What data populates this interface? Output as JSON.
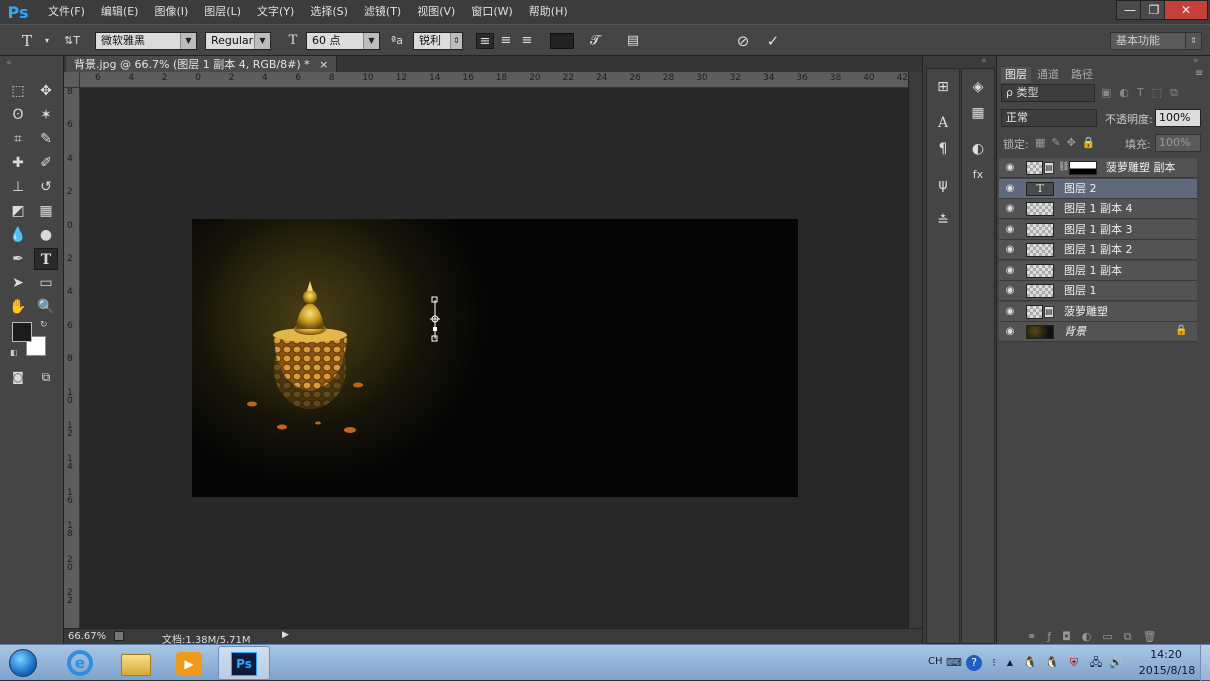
{
  "app": {
    "logo": "Ps",
    "menus": [
      "文件(F)",
      "编辑(E)",
      "图像(I)",
      "图层(L)",
      "文字(Y)",
      "选择(S)",
      "滤镜(T)",
      "视图(V)",
      "窗口(W)",
      "帮助(H)"
    ],
    "window_controls": {
      "minimize": "—",
      "restore": "❐",
      "close": "✕"
    }
  },
  "options": {
    "tool_glyph": "T",
    "orient_glyph": "⇅T",
    "font_family": "微软雅黑",
    "font_style": "Regular",
    "size_glyph": "T",
    "font_size": "60 点",
    "aa_glyph": "ªa",
    "anti_alias": "锐利",
    "text_color": "#222222",
    "workspace": "基本功能"
  },
  "document": {
    "tab_title": "背景.jpg @ 66.7% (图层 1 副本 4, RGB/8#) *",
    "tab_close": "×",
    "zoom": "66.67%",
    "doc_size": "文档:1.38M/5.71M",
    "ruler_h_labels": [
      "6",
      "4",
      "2",
      "0",
      "2",
      "4",
      "6",
      "8",
      "10",
      "12",
      "14",
      "16",
      "18",
      "20",
      "22",
      "24",
      "26",
      "28",
      "30",
      "32",
      "34",
      "36",
      "38",
      "40",
      "42"
    ],
    "ruler_v_labels": [
      "8",
      "6",
      "4",
      "2",
      "0",
      "2",
      "4",
      "6",
      "8",
      "1 0",
      "1 2",
      "1 4",
      "1 6",
      "1 8",
      "2 0",
      "2 2"
    ]
  },
  "layers_panel": {
    "tabs": [
      "图层",
      "通道",
      "路径"
    ],
    "filter_kind": "ρ 类型",
    "blend_mode": "正常",
    "opacity_label": "不透明度:",
    "opacity_value": "100%",
    "lock_label": "锁定:",
    "fill_label": "填充:",
    "fill_value": "100%",
    "layers": [
      {
        "name": "菠萝雕塑 副本",
        "kind": "smart-masked",
        "selected": false
      },
      {
        "name": "图层 2",
        "kind": "text",
        "selected": true
      },
      {
        "name": "图层 1 副本 4",
        "kind": "normal",
        "selected": false
      },
      {
        "name": "图层 1 副本 3",
        "kind": "normal",
        "selected": false
      },
      {
        "name": "图层 1 副本 2",
        "kind": "normal",
        "selected": false
      },
      {
        "name": "图层 1 副本",
        "kind": "normal",
        "selected": false
      },
      {
        "name": "图层 1",
        "kind": "normal",
        "selected": false
      },
      {
        "name": "菠萝雕塑",
        "kind": "smart",
        "selected": false
      },
      {
        "name": "背景",
        "kind": "background",
        "selected": false
      }
    ]
  },
  "taskbar": {
    "lang": "CH",
    "time": "14:20",
    "date": "2015/8/18"
  }
}
